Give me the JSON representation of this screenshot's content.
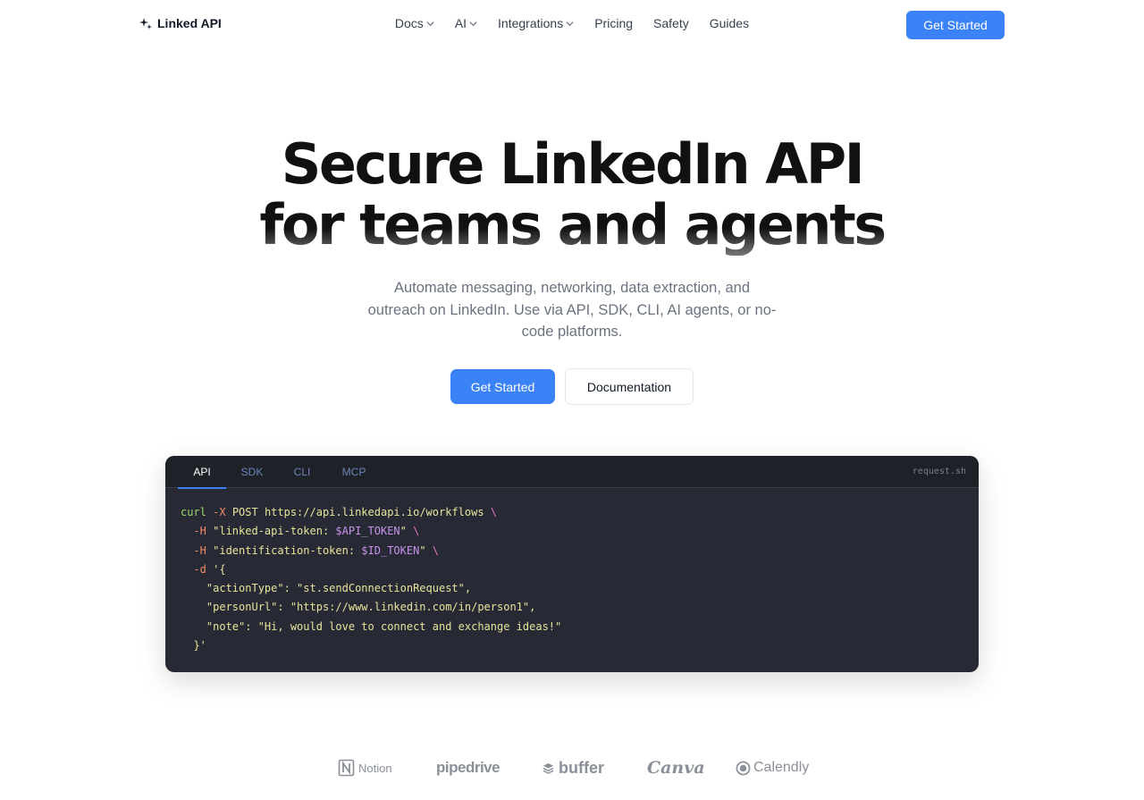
{
  "nav": {
    "brand": "Linked API",
    "links": [
      {
        "label": "Docs",
        "dropdown": true
      },
      {
        "label": "AI",
        "dropdown": true
      },
      {
        "label": "Integrations",
        "dropdown": true
      },
      {
        "label": "Pricing",
        "dropdown": false
      },
      {
        "label": "Safety",
        "dropdown": false
      },
      {
        "label": "Guides",
        "dropdown": false
      }
    ],
    "cta": "Get Started"
  },
  "hero": {
    "title_line1": "Secure LinkedIn API",
    "title_line2": "for teams and agents",
    "subtitle": "Automate messaging, networking, data extraction, and outreach on LinkedIn. Use via API, SDK, CLI, AI agents, or no-code platforms.",
    "primary_button": "Get Started",
    "secondary_button": "Documentation"
  },
  "code_panel": {
    "tabs": [
      "API",
      "SDK",
      "CLI",
      "MCP"
    ],
    "active_tab": "API",
    "filename": "request.sh",
    "lines": [
      [
        {
          "t": "curl",
          "c": "g"
        },
        {
          "t": " -X ",
          "c": "o"
        },
        {
          "t": "POST ",
          "c": "y"
        },
        {
          "t": "https://api.linkedapi.io/workflows ",
          "c": "y"
        },
        {
          "t": "\\",
          "c": "p"
        }
      ],
      [
        {
          "t": "  -H ",
          "c": "o"
        },
        {
          "t": "\"linked-api-token: ",
          "c": "y"
        },
        {
          "t": "$API_TOKEN",
          "c": "v"
        },
        {
          "t": "\" ",
          "c": "y"
        },
        {
          "t": "\\",
          "c": "p"
        }
      ],
      [
        {
          "t": "  -H ",
          "c": "o"
        },
        {
          "t": "\"identification-token: ",
          "c": "y"
        },
        {
          "t": "$ID_TOKEN",
          "c": "v"
        },
        {
          "t": "\" ",
          "c": "y"
        },
        {
          "t": "\\",
          "c": "p"
        }
      ],
      [
        {
          "t": "  -d ",
          "c": "o"
        },
        {
          "t": "'{",
          "c": "y"
        }
      ],
      [
        {
          "t": "    \"actionType\": \"st.sendConnectionRequest\",",
          "c": "y"
        }
      ],
      [
        {
          "t": "    \"personUrl\": \"https://www.linkedin.com/in/person1\",",
          "c": "y"
        }
      ],
      [
        {
          "t": "    \"note\": \"Hi, would love to connect and exchange ideas!\"",
          "c": "y"
        }
      ],
      [
        {
          "t": "  }'",
          "c": "y"
        }
      ]
    ]
  },
  "partners": [
    "Notion",
    "pipedrive",
    "buffer",
    "Canva",
    "Calendly"
  ],
  "colors": {
    "accent": "#3b82f6",
    "code_bg": "#272a35"
  }
}
